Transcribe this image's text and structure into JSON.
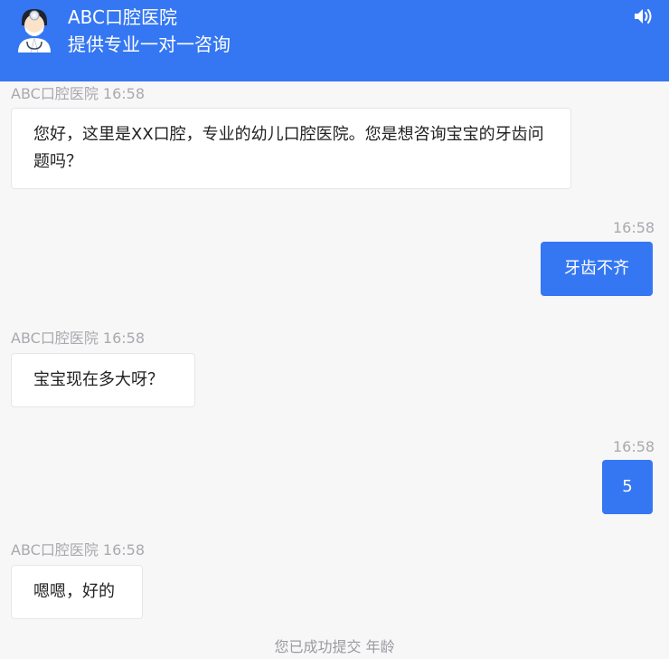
{
  "header": {
    "title": "ABC口腔医院",
    "subtitle": "提供专业一对一咨询",
    "avatar_icon": "doctor-avatar-icon",
    "sound_icon": "speaker-icon"
  },
  "messages": [
    {
      "side": "left",
      "sender_time": "ABC口腔医院 16:58",
      "text": "您好，这里是XX口腔，专业的幼儿口腔医院。您是想咨询宝宝的牙齿问题吗？"
    },
    {
      "side": "right",
      "time": "16:58",
      "text": "牙齿不齐"
    },
    {
      "side": "left",
      "sender_time": "ABC口腔医院 16:58",
      "text": "宝宝现在多大呀？"
    },
    {
      "side": "right",
      "time": "16:58",
      "text": "5"
    },
    {
      "side": "left",
      "sender_time": "ABC口腔医院 16:58",
      "text": "嗯嗯，好的"
    }
  ],
  "status": {
    "text": "您已成功提交 年龄"
  },
  "colors": {
    "accent": "#3577f2",
    "background": "#f7f7f8",
    "meta_text": "#a9a9ae"
  }
}
